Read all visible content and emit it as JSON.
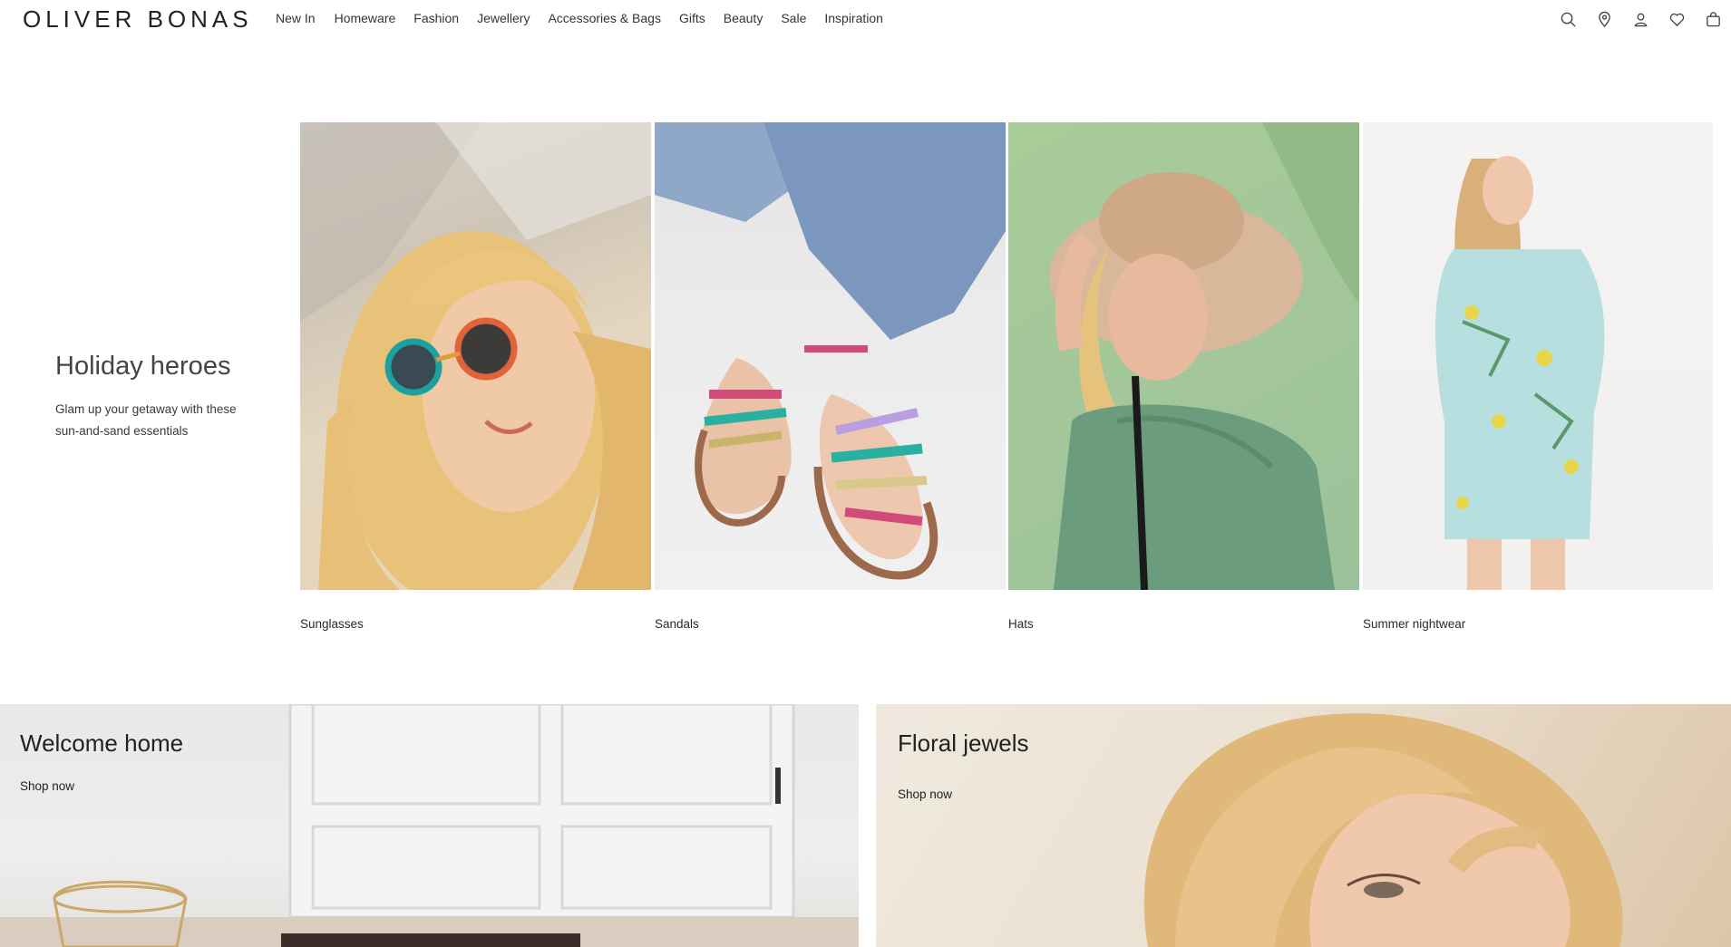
{
  "header": {
    "logo": "OLIVER BONAS",
    "nav": [
      "New In",
      "Homeware",
      "Fashion",
      "Jewellery",
      "Accessories & Bags",
      "Gifts",
      "Beauty",
      "Sale",
      "Inspiration"
    ],
    "icons": [
      "search-icon",
      "store-locator-icon",
      "account-icon",
      "wishlist-icon",
      "basket-icon"
    ]
  },
  "intro": {
    "title": "Holiday heroes",
    "text": "Glam up your getaway with these sun-and-sand essentials"
  },
  "tiles": [
    {
      "label": "Sunglasses"
    },
    {
      "label": "Sandals"
    },
    {
      "label": "Hats"
    },
    {
      "label": "Summer nightwear"
    }
  ],
  "banners": [
    {
      "title": "Welcome home",
      "link": "Shop now"
    },
    {
      "title": "Floral jewels",
      "link": "Shop now"
    }
  ]
}
